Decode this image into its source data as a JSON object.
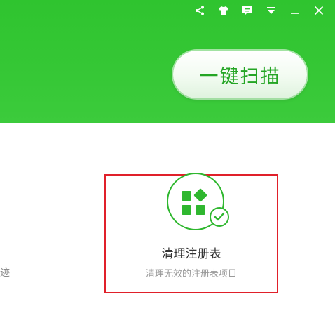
{
  "titlebar": {
    "icons": [
      "share-icon",
      "skin-icon",
      "feedback-icon",
      "dropdown-menu-icon",
      "minimize-icon",
      "close-icon"
    ]
  },
  "header": {
    "scan_button_label": "一键扫描"
  },
  "left_edge": {
    "text": "迹"
  },
  "registry_card": {
    "title": "清理注册表",
    "description": "清理无效的注册表项目"
  },
  "colors": {
    "header_green": "#35c735",
    "accent_green": "#2fb72f",
    "highlight_red": "#e0202a"
  }
}
